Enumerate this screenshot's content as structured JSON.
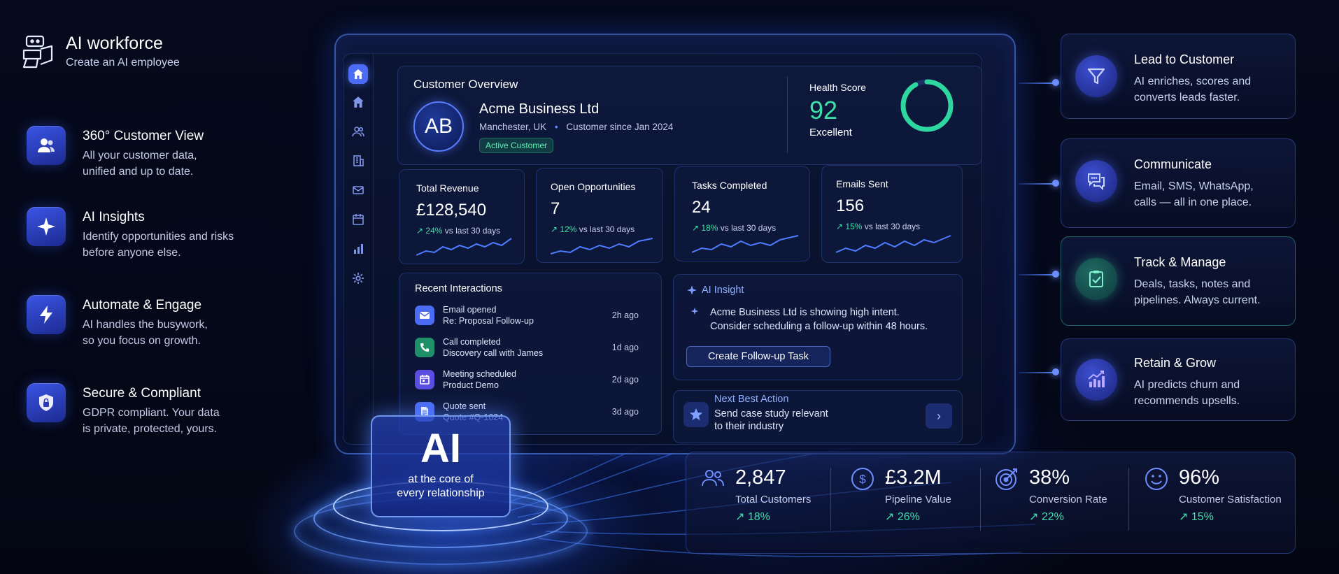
{
  "brand": {
    "title": "AI workforce",
    "subtitle": "Create an AI employee",
    "icon": "robot-icon"
  },
  "features": [
    {
      "title": "360° Customer View",
      "line1": "All your customer data,",
      "line2": "unified and up to date.",
      "icon": "users-icon"
    },
    {
      "title": "AI Insights",
      "line1": "Identify opportunities and risks",
      "line2": "before anyone else.",
      "icon": "sparkle-icon"
    },
    {
      "title": "Automate & Engage",
      "line1": "AI handles the busywork,",
      "line2": "so you focus on growth.",
      "icon": "lightning-icon"
    },
    {
      "title": "Secure & Compliant",
      "line1": "GDPR compliant. Your data",
      "line2": "is private, protected, yours.",
      "icon": "shield-lock-icon"
    }
  ],
  "overview": {
    "title": "Customer Overview",
    "initials": "AB",
    "company": "Acme Business Ltd",
    "location": "Manchester, UK",
    "since": "Customer since Jan 2024",
    "status": "Active Customer",
    "health_label": "Health Score",
    "health_value": "92",
    "health_text": "Excellent",
    "health_fraction": 0.92
  },
  "stats": [
    {
      "title": "Total Revenue",
      "value": "£128,540",
      "delta": "24%",
      "suffix": "vs last 30 days"
    },
    {
      "title": "Open Opportunities",
      "value": "7",
      "delta": "12%",
      "suffix": "vs last 30 days"
    },
    {
      "title": "Tasks Completed",
      "value": "24",
      "delta": "18%",
      "suffix": "vs last 30 days"
    },
    {
      "title": "Emails Sent",
      "value": "156",
      "delta": "15%",
      "suffix": "vs last 30 days"
    }
  ],
  "interactions": {
    "title": "Recent Interactions",
    "items": [
      {
        "line1": "Email opened",
        "line2": "Re: Proposal Follow-up",
        "time": "2h ago",
        "icon": "mail-icon",
        "color": "#4d6cf5"
      },
      {
        "line1": "Call completed",
        "line2": "Discovery call with James",
        "time": "1d ago",
        "icon": "phone-icon",
        "color": "#1f8f6a"
      },
      {
        "line1": "Meeting scheduled",
        "line2": "Product Demo",
        "time": "2d ago",
        "icon": "calendar-icon",
        "color": "#5a4de0"
      },
      {
        "line1": "Quote sent",
        "line2": "Quote #Q-1024",
        "time": "3d ago",
        "icon": "document-icon",
        "color": "#4d6cf5"
      }
    ]
  },
  "insight": {
    "title": "AI Insight",
    "line1": "Acme Business Ltd is showing high intent.",
    "line2": "Consider scheduling a follow-up within 48 hours.",
    "button": "Create Follow-up Task"
  },
  "next_action": {
    "title": "Next Best Action",
    "line1": "Send case study relevant",
    "line2": "to their industry"
  },
  "ai_core": {
    "big": "AI",
    "line1": "at the core of",
    "line2": "every relationship"
  },
  "right_cards": [
    {
      "title": "Lead to Customer",
      "line1": "AI enriches, scores and",
      "line2": "converts leads faster.",
      "icon": "funnel-icon"
    },
    {
      "title": "Communicate",
      "line1": "Email, SMS, WhatsApp,",
      "line2": "calls — all in one place.",
      "icon": "chat-icon"
    },
    {
      "title": "Track & Manage",
      "line1": "Deals, tasks, notes and",
      "line2": "pipelines. Always current.",
      "icon": "clipboard-check-icon"
    },
    {
      "title": "Retain & Grow",
      "line1": "AI predicts churn and",
      "line2": "recommends upsells.",
      "icon": "growth-chart-icon"
    }
  ],
  "bottom_stats": [
    {
      "value": "2,847",
      "label": "Total Customers",
      "delta": "18%",
      "icon": "users-icon"
    },
    {
      "value": "£3.2M",
      "label": "Pipeline Value",
      "delta": "26%",
      "icon": "dollar-icon"
    },
    {
      "value": "38%",
      "label": "Conversion Rate",
      "delta": "22%",
      "icon": "target-icon"
    },
    {
      "value": "96%",
      "label": "Customer Satisfaction",
      "delta": "15%",
      "icon": "smile-icon"
    }
  ],
  "colors": {
    "accent": "#4d6cf5",
    "positive": "#3de0a8",
    "background": "#050a1c"
  }
}
